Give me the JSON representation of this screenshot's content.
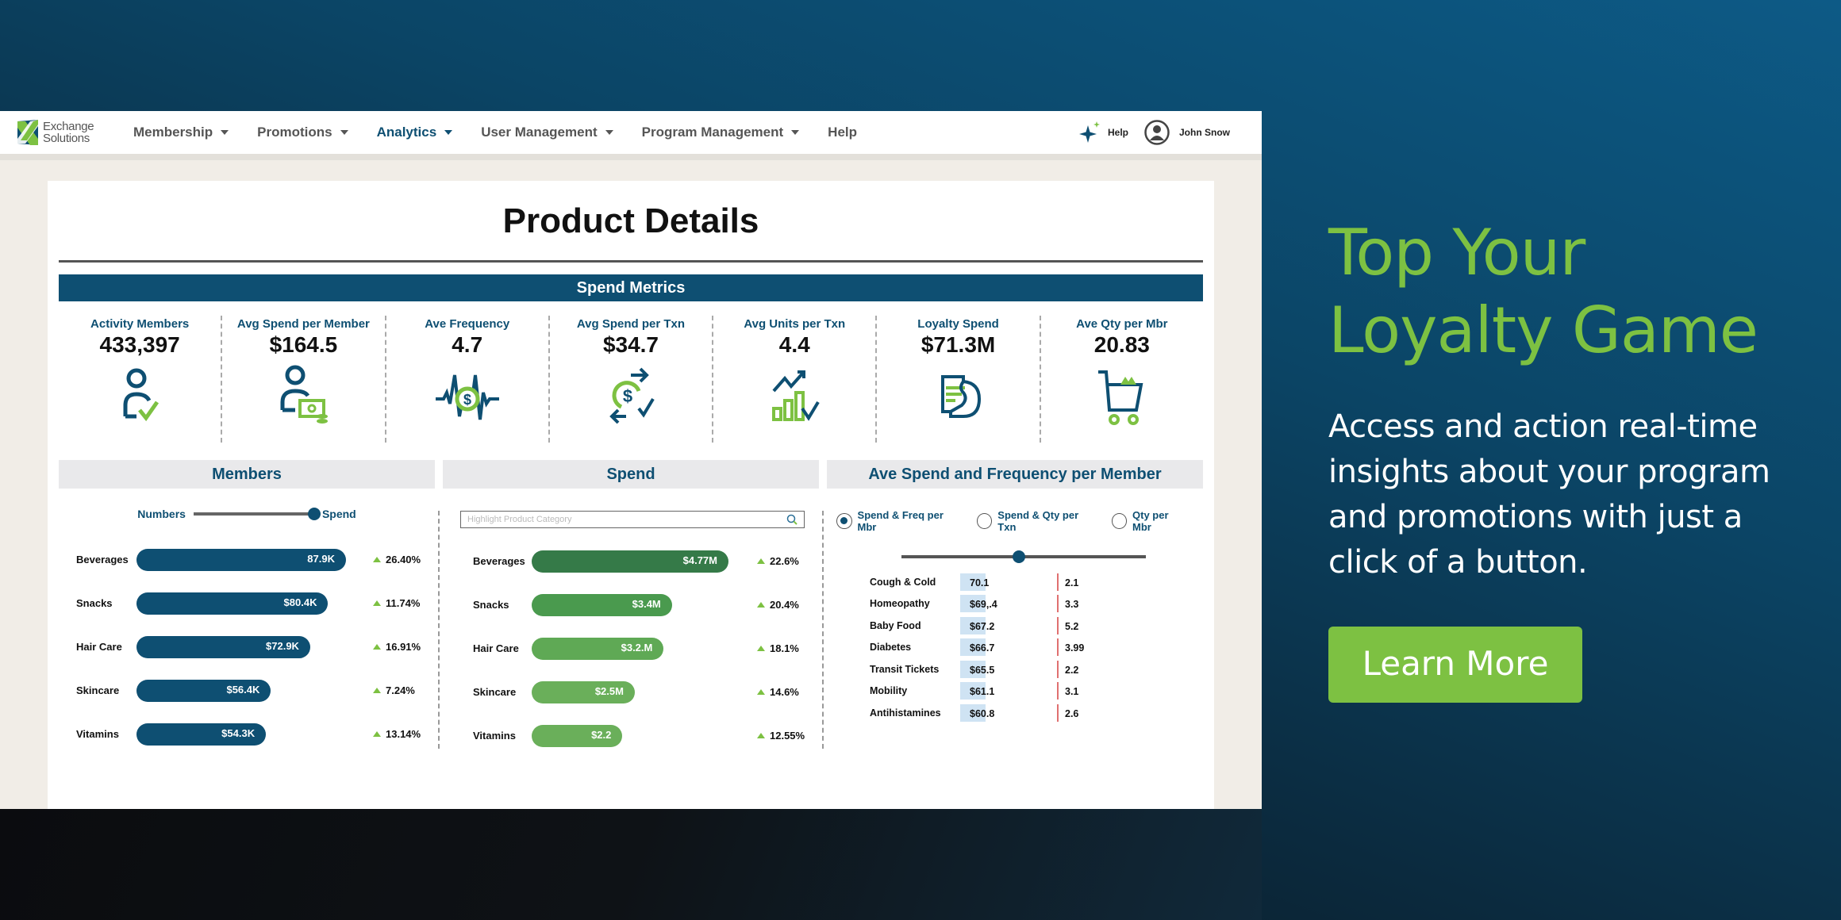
{
  "app": {
    "logo": {
      "line1": "Exchange",
      "line2": "Solutions"
    },
    "nav": [
      {
        "label": "Membership",
        "dropdown": true
      },
      {
        "label": "Promotions",
        "dropdown": true
      },
      {
        "label": "Analytics",
        "dropdown": true,
        "active": true
      },
      {
        "label": "User Management",
        "dropdown": true
      },
      {
        "label": "Program Management",
        "dropdown": true
      },
      {
        "label": "Help",
        "dropdown": false
      }
    ],
    "help_label": "Help",
    "user_name": "John Snow"
  },
  "page": {
    "title": "Product Details",
    "metrics_header": "Spend Metrics",
    "metrics": [
      {
        "label": "Activity Members",
        "value": "433,397",
        "icon": "member-check-icon"
      },
      {
        "label": "Avg Spend per Member",
        "value": "$164.5",
        "icon": "member-cash-icon"
      },
      {
        "label": "Ave Frequency",
        "value": "4.7",
        "icon": "dollar-pulse-icon"
      },
      {
        "label": "Avg Spend per Txn",
        "value": "$34.7",
        "icon": "dollar-exchange-icon"
      },
      {
        "label": "Avg Units per Txn",
        "value": "4.4",
        "icon": "growth-chart-icon"
      },
      {
        "label": "Loyalty Spend",
        "value": "$71.3M",
        "icon": "card-hand-icon"
      },
      {
        "label": "Ave Qty per Mbr",
        "value": "20.83",
        "icon": "shopping-cart-icon"
      }
    ]
  },
  "members": {
    "title": "Members",
    "toggle_left": "Numbers",
    "toggle_right": "Spend",
    "toggle_position": 1.0,
    "color": "#0e4f72",
    "rows": [
      {
        "label": "Beverages",
        "value": 87.9,
        "display": "87.9K",
        "change": "26.40%"
      },
      {
        "label": "Snacks",
        "value": 80.4,
        "display": "$80.4K",
        "change": "11.74%"
      },
      {
        "label": "Hair Care",
        "value": 72.9,
        "display": "$72.9K",
        "change": "16.91%"
      },
      {
        "label": "Skincare",
        "value": 56.4,
        "display": "$56.4K",
        "change": "7.24%"
      },
      {
        "label": "Vitamins",
        "value": 54.3,
        "display": "$54.3K",
        "change": "13.14%"
      }
    ]
  },
  "spend": {
    "title": "Spend",
    "search_placeholder": "Highlight Product Category",
    "rows": [
      {
        "label": "Beverages",
        "value": 4.77,
        "display": "$4.77M",
        "change": "22.6%",
        "color": "#357a48"
      },
      {
        "label": "Snacks",
        "value": 3.4,
        "display": "$3.4M",
        "change": "20.4%",
        "color": "#4a9a4e"
      },
      {
        "label": "Hair Care",
        "value": 3.2,
        "display": "$3.2.M",
        "change": "18.1%",
        "color": "#5fa955"
      },
      {
        "label": "Skincare",
        "value": 2.5,
        "display": "$2.5M",
        "change": "14.6%",
        "color": "#6aaf5a"
      },
      {
        "label": "Vitamins",
        "value": 2.2,
        "display": "$2.2",
        "change": "12.55%",
        "color": "#6aaf5a"
      }
    ]
  },
  "avg": {
    "title": "Ave Spend and Frequency per Member",
    "options": [
      {
        "label": "Spend & Freq per Mbr",
        "selected": true
      },
      {
        "label": "Spend & Qty per Txn",
        "selected": false
      },
      {
        "label": "Qty per Mbr",
        "selected": false
      }
    ],
    "slider_position": 0.48,
    "rows": [
      {
        "label": "Cough & Cold",
        "spend": "70.1",
        "freq": "2.1"
      },
      {
        "label": "Homeopathy",
        "spend": "$69,.4",
        "freq": "3.3"
      },
      {
        "label": "Baby Food",
        "spend": "$67.2",
        "freq": "5.2"
      },
      {
        "label": "Diabetes",
        "spend": "$66.7",
        "freq": "3.99"
      },
      {
        "label": "Transit Tickets",
        "spend": "$65.5",
        "freq": "2.2"
      },
      {
        "label": "Mobility",
        "spend": "$61.1",
        "freq": "3.1"
      },
      {
        "label": "Antihistamines",
        "spend": "$60.8",
        "freq": "2.6"
      }
    ]
  },
  "promo": {
    "headline_line1": "Top Your",
    "headline_line2": "Loyalty Game",
    "body": "Access and action real-time insights about your program and promotions with just a click of a button.",
    "cta": "Learn More",
    "accent": "#7dc142"
  }
}
